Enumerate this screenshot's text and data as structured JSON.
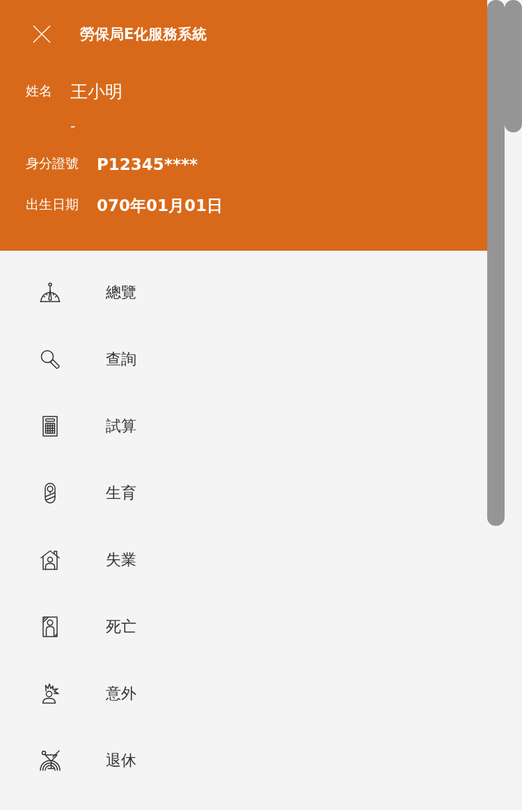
{
  "header": {
    "title": "勞保局E化服務系統"
  },
  "profile": {
    "name": {
      "label": "姓名",
      "value": "王小明",
      "second_line": "-"
    },
    "fields": [
      {
        "label": "身分證號",
        "value": "P12345****"
      },
      {
        "label": "出生日期",
        "value": "070年01月01日"
      }
    ]
  },
  "menu": [
    {
      "kind": "overview",
      "label": "總覽"
    },
    {
      "kind": "search",
      "label": "查詢"
    },
    {
      "kind": "calculator",
      "label": "試算"
    },
    {
      "kind": "birth",
      "label": "生育"
    },
    {
      "kind": "unemployment",
      "label": "失業"
    },
    {
      "kind": "death",
      "label": "死亡"
    },
    {
      "kind": "accident",
      "label": "意外"
    },
    {
      "kind": "retirement",
      "label": "退休"
    }
  ]
}
